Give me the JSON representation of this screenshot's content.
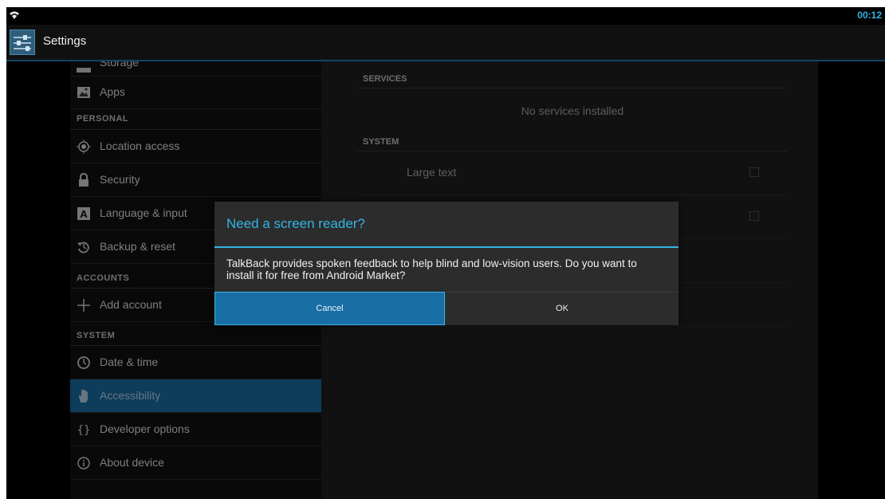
{
  "statusbar": {
    "time": "00:12",
    "wifi_icon": "wifi-icon"
  },
  "actionbar": {
    "title": "Settings",
    "icon": "settings-sliders-icon"
  },
  "sidebar": {
    "cut_off_item": "Storage",
    "items": [
      {
        "label": "Apps",
        "icon": "apps-icon"
      },
      {
        "label": "Location access",
        "icon": "location-icon"
      },
      {
        "label": "Security",
        "icon": "lock-icon"
      },
      {
        "label": "Language & input",
        "icon": "keyboard-a-icon"
      },
      {
        "label": "Backup & reset",
        "icon": "backup-icon"
      },
      {
        "label": "Add account",
        "icon": "plus-icon"
      },
      {
        "label": "Date & time",
        "icon": "clock-icon"
      },
      {
        "label": "Accessibility",
        "icon": "hand-icon",
        "active": true
      },
      {
        "label": "Developer options",
        "icon": "braces-icon"
      },
      {
        "label": "About device",
        "icon": "info-icon"
      }
    ],
    "sections": {
      "personal": "PERSONAL",
      "accounts": "ACCOUNTS",
      "system": "SYSTEM"
    }
  },
  "right_pane": {
    "services_header": "SERVICES",
    "no_services": "No services installed",
    "system_header": "SYSTEM",
    "items": [
      {
        "label": "Large text",
        "checked": false
      }
    ]
  },
  "dialog": {
    "title": "Need a screen reader?",
    "message": "TalkBack provides spoken feedback to help blind and low-vision users. Do you want to install it for free from Android Market?",
    "cancel_label": "Cancel",
    "ok_label": "OK"
  },
  "colors": {
    "accent": "#33b5e5",
    "selected": "#1a6ea6",
    "background": "#000000"
  }
}
